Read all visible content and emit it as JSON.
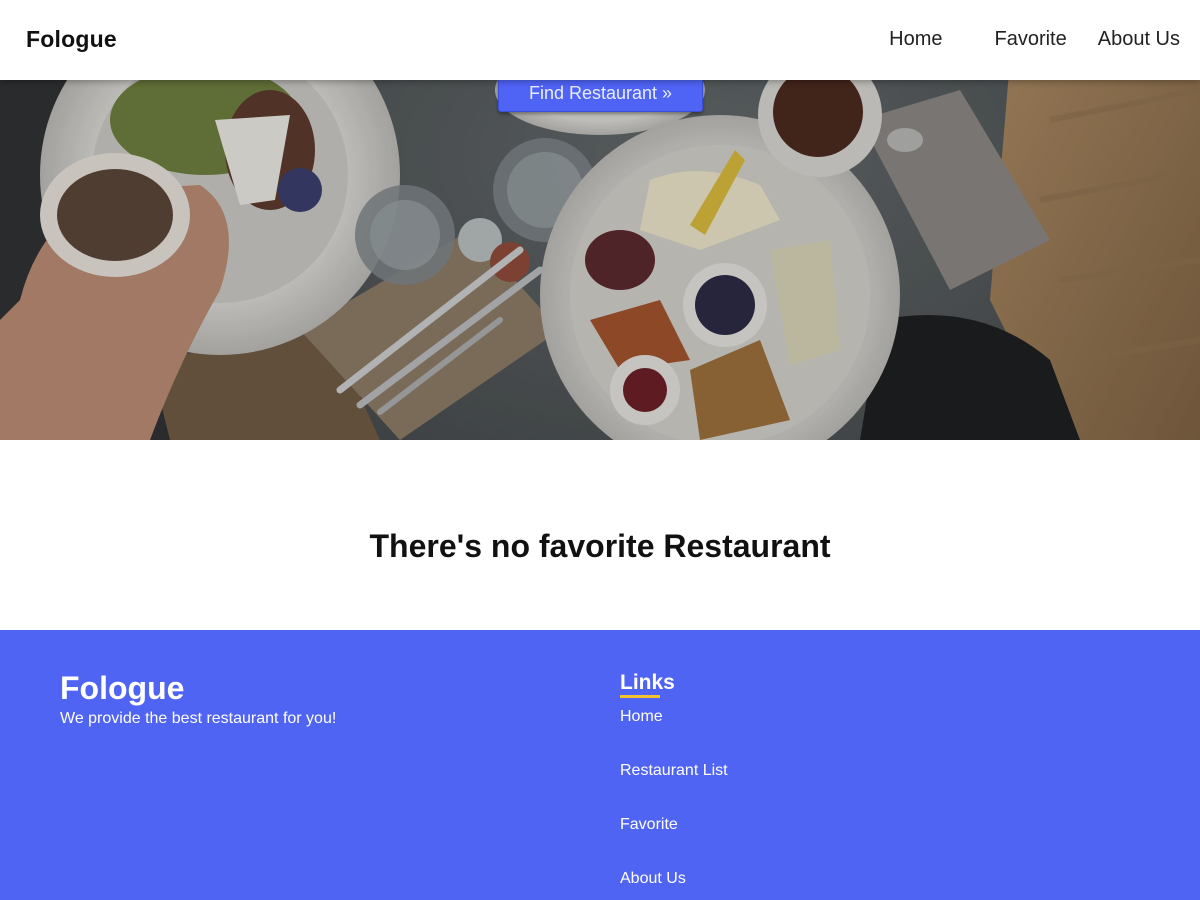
{
  "header": {
    "brand": "Fologue",
    "nav": {
      "home": "Home",
      "favorite": "Favorite",
      "about": "About Us"
    }
  },
  "hero": {
    "button_label": "Find Restaurant »"
  },
  "main": {
    "empty_message": "There's no favorite Restaurant"
  },
  "footer": {
    "brand": "Fologue",
    "tagline": "We provide the best restaurant for you!",
    "links_title": "Links",
    "links": [
      "Home",
      "Restaurant List",
      "Favorite",
      "About Us"
    ]
  },
  "colors": {
    "accent": "#5064f4",
    "button": "#4f63f5",
    "links_underline": "#f2c230",
    "header_bg": "#ffffff"
  }
}
